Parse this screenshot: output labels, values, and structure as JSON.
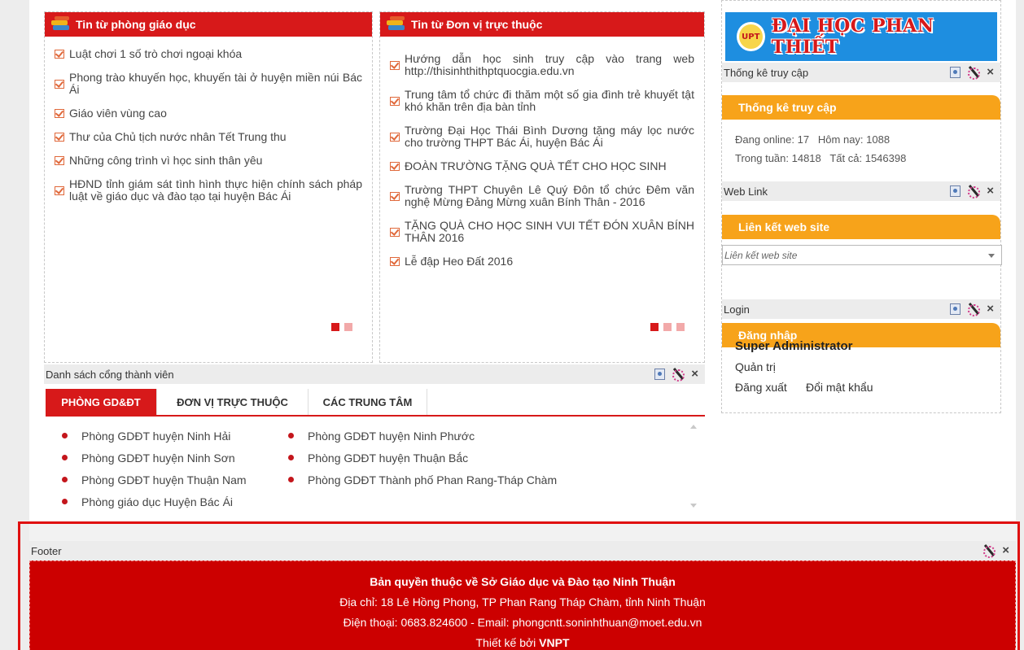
{
  "edu_news": {
    "title": "Tin từ phòng giáo dục",
    "items": [
      "Luật chơi 1 số trò chơi ngoại khóa",
      "Phong trào khuyến học, khuyến tài ở huyện miền núi Bác Ái",
      "Giáo viên vùng cao",
      "Thư của Chủ tịch nước nhân Tết Trung thu",
      "Những công trình vì học sinh thân yêu",
      "HĐND tỉnh giám sát tình hình thực hiện chính sách pháp luật về giáo dục và đào tạo tại huyện Bác Ái"
    ]
  },
  "unit_news": {
    "title": "Tin từ Đơn vị trực thuộc",
    "items": [
      "Hướng dẫn học sinh truy cập vào trang web http://thisinhthithptquocgia.edu.vn",
      "Trung tâm tổ chức đi thăm một số gia đình trẻ khuyết tật khó khăn trên địa bàn tỉnh",
      "Trường Đại Học Thái Bình Dương tặng máy lọc nước cho trường THPT Bác Ái, huyện Bác Ái",
      "ĐOÀN TRƯỜNG TẶNG QUÀ TẾT CHO HỌC SINH",
      "Trường THPT Chuyên Lê Quý Đôn tổ chức Đêm văn nghệ Mừng Đảng Mừng xuân Bính Thân - 2016",
      "TẶNG QUÀ CHO HỌC SINH VUI TẾT ĐÓN XUÂN BÍNH THÂN 2016",
      "Lễ đập Heo Đất 2016"
    ]
  },
  "members": {
    "bar_title": "Danh sách cổng thành viên",
    "tabs": [
      "PHÒNG GD&ĐT",
      "ĐƠN VỊ TRỰC THUỘC",
      "CÁC TRUNG TÂM"
    ],
    "active_tab": 0,
    "col1": [
      "Phòng GDĐT huyện Ninh Hải",
      "Phòng GDĐT huyện Ninh Sơn",
      "Phòng GDĐT huyện Thuận Nam",
      "Phòng giáo dục Huyện Bác Ái"
    ],
    "col2": [
      "Phòng GDĐT huyện Ninh Phước",
      "Phòng GDĐT huyện Thuận Bắc",
      "Phòng GDĐT Thành phố Phan Rang-Tháp Chàm"
    ]
  },
  "logo": {
    "badge": "UPT",
    "text": "ĐẠI HỌC PHAN THIẾT"
  },
  "stats": {
    "bar_title": "Thống kê truy cập",
    "header": "Thống kê truy cập",
    "line1": "Đang online: 17   Hôm nay: 1088",
    "line2": "Trong tuần: 14818   Tất cả: 1546398"
  },
  "weblink": {
    "bar_title": "Web Link",
    "header": "Liên kết web site",
    "select_value": "Liên kết web site"
  },
  "login": {
    "bar_title": "Login",
    "header": "Đăng nhập",
    "user": "Super Administrator",
    "admin_link": "Quản trị",
    "logout_link": "Đăng xuất",
    "change_pw_link": "Đổi mật khẩu"
  },
  "footer": {
    "bar_title": "Footer",
    "copyright": "Bản quyền thuộc về Sở Giáo dục và Đào tạo Ninh Thuận",
    "address": "Địa chỉ: 18 Lê Hồng Phong, TP Phan Rang Tháp Chàm, tỉnh Ninh Thuận",
    "contact": "Điện thoại: 0683.824600  -  Email: phongcntt.soninhthuan@moet.edu.vn",
    "design_prefix": "Thiết kế bởi ",
    "design_brand": "VNPT"
  },
  "colors": {
    "primary_red": "#d7191a",
    "orange": "#f7a31a",
    "logo_blue": "#1e8ee0",
    "footer_red": "#cc0000"
  },
  "icons": [
    "books-icon",
    "checkbox-bullet-icon",
    "edit-document-icon",
    "design-tool-icon",
    "close-icon",
    "red-dot-bullet-icon"
  ]
}
